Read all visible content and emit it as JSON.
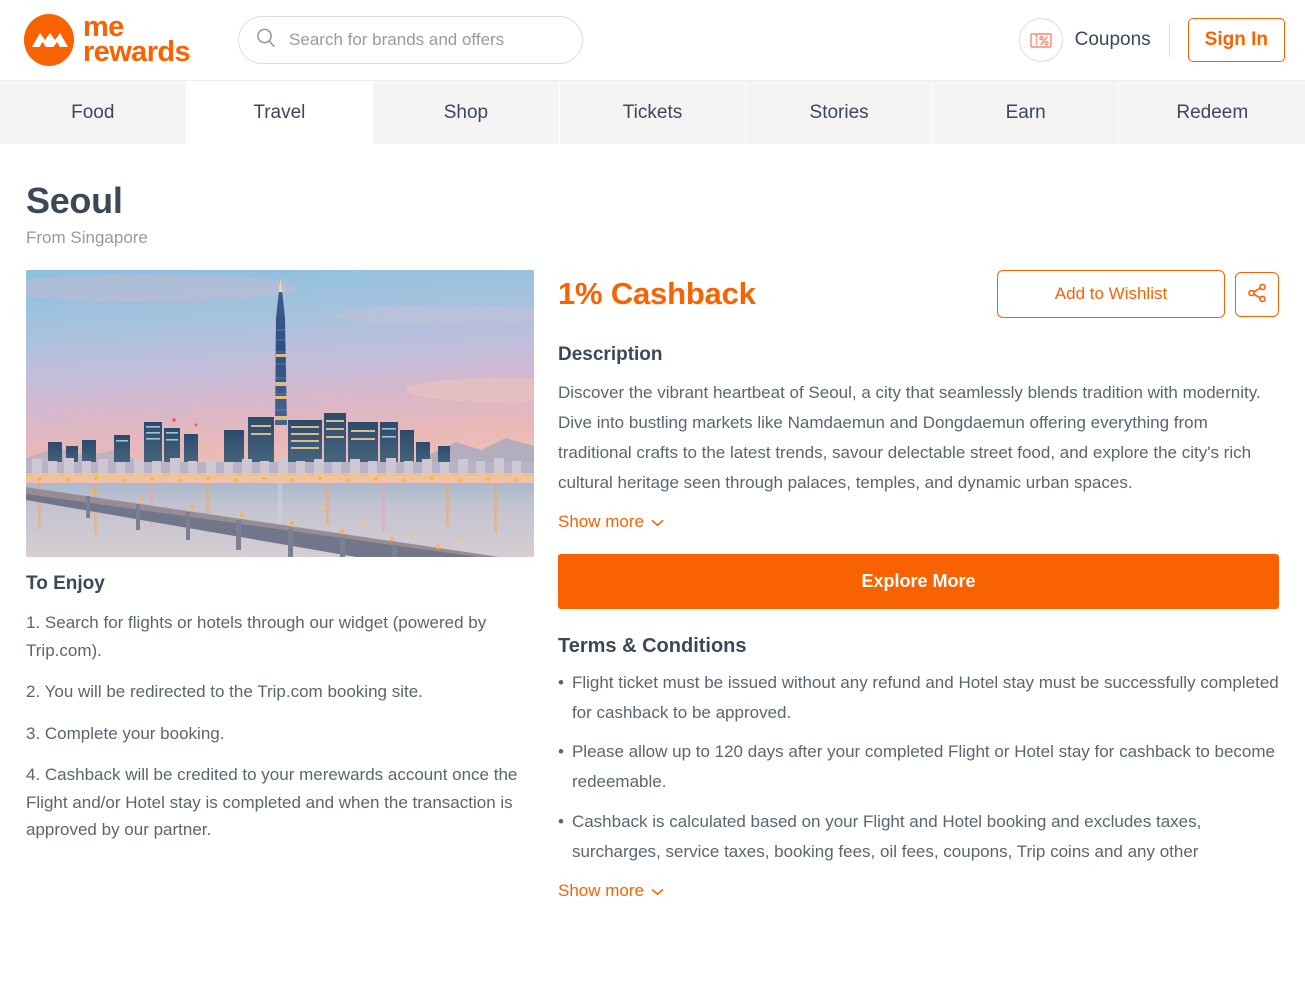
{
  "brand": {
    "name_line1": "me",
    "name_line2": "rewards",
    "accent": "#f96200",
    "text_dark": "#3c4858",
    "text_body": "#5a6570",
    "muted": "#9a9a9a"
  },
  "header": {
    "search": {
      "placeholder": "Search for brands and offers",
      "value": "",
      "icon": "search-icon"
    },
    "coupons_label": "Coupons",
    "coupons_icon": "coupon-percent-icon",
    "sign_in_label": "Sign In"
  },
  "nav": {
    "items": [
      {
        "label": "Food",
        "active": false
      },
      {
        "label": "Travel",
        "active": true
      },
      {
        "label": "Shop",
        "active": false
      },
      {
        "label": "Tickets",
        "active": false
      },
      {
        "label": "Stories",
        "active": false
      },
      {
        "label": "Earn",
        "active": false
      },
      {
        "label": "Redeem",
        "active": false
      }
    ]
  },
  "offer": {
    "title": "Seoul",
    "subtitle": "From Singapore",
    "image_alt": "seoul-skyline-lotte-world-tower-at-dusk",
    "cashback_title": "1% Cashback",
    "wishlist_label": "Add to Wishlist",
    "share_icon": "share-icon",
    "description_heading": "Description",
    "description_body": "Discover the vibrant heartbeat of Seoul, a city that seamlessly blends tradition with modernity. Dive into bustling markets like Namdaemun and Dongdaemun offering everything from traditional crafts to the latest trends, savour delectable street food, and explore the city's rich cultural heritage seen through palaces, temples, and dynamic urban spaces.",
    "description_show_more": "Show more",
    "explore_label": "Explore More",
    "terms_heading": "Terms & Conditions",
    "terms_items": [
      "Flight ticket must be issued without any refund and Hotel stay must be successfully completed for cashback to be approved.",
      "Please allow up to 120 days after your completed Flight or Hotel stay for cashback to become redeemable.",
      "Cashback is calculated based on your Flight and Hotel booking and excludes taxes, surcharges, service taxes, booking fees, oil fees, coupons, Trip coins and any other"
    ],
    "terms_bullet": "•",
    "terms_show_more": "Show more",
    "to_enjoy_heading": "To Enjoy",
    "to_enjoy_items": [
      "1. Search for flights or hotels through our widget (powered by Trip.com).",
      "2. You will be redirected to the Trip.com booking site.",
      "3. Complete your booking.",
      "4. Cashback will be credited to your merewards account once the Flight and/or Hotel stay is completed and when the transaction is approved by our partner."
    ]
  }
}
